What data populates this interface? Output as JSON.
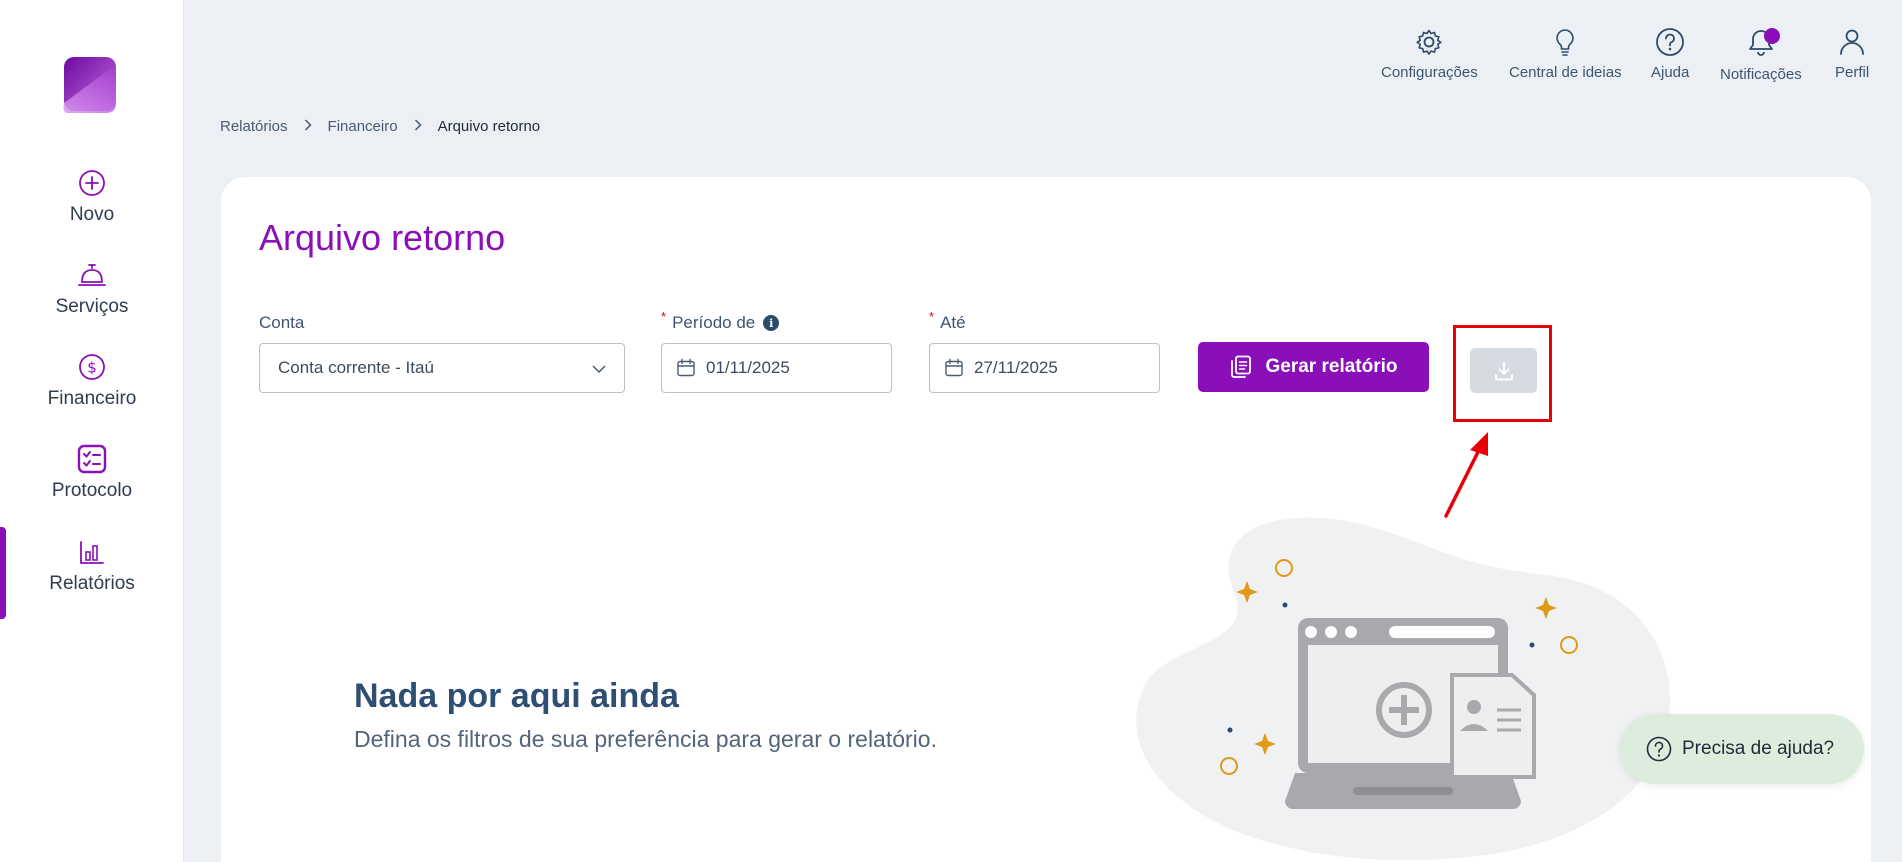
{
  "sidebar": {
    "items": [
      {
        "label": "Novo",
        "icon": "plus-circle-icon"
      },
      {
        "label": "Serviços",
        "icon": "service-bell-icon"
      },
      {
        "label": "Financeiro",
        "icon": "dollar-circle-icon"
      },
      {
        "label": "Protocolo",
        "icon": "checklist-icon"
      },
      {
        "label": "Relatórios",
        "icon": "bar-chart-icon",
        "active": true
      }
    ]
  },
  "topbar": {
    "items": [
      {
        "label": "Configurações",
        "icon": "gear-icon"
      },
      {
        "label": "Central de ideias",
        "icon": "lightbulb-icon"
      },
      {
        "label": "Ajuda",
        "icon": "help-icon"
      },
      {
        "label": "Notificações",
        "icon": "bell-icon"
      },
      {
        "label": "Perfil",
        "icon": "user-icon"
      }
    ]
  },
  "breadcrumb": {
    "items": [
      "Relatórios",
      "Financeiro",
      "Arquivo retorno"
    ]
  },
  "page": {
    "title": "Arquivo retorno"
  },
  "filters": {
    "account_label": "Conta",
    "account_value": "Conta corrente - Itaú",
    "from_required": "*",
    "from_label": "Período de",
    "from_value": "01/11/2025",
    "to_required": "*",
    "to_label": "Até",
    "to_value": "27/11/2025",
    "info_glyph": "i"
  },
  "actions": {
    "generate_label": "Gerar relatório"
  },
  "empty_state": {
    "title": "Nada por aqui ainda",
    "subtitle": "Defina os filtros de sua preferência para gerar o relatório."
  },
  "help": {
    "label": "Precisa de ajuda?"
  },
  "colors": {
    "brand": "#8a0fb8",
    "annotation": "#e8000b",
    "disabled": "#d6dbe1",
    "help_bg": "#dcedde"
  }
}
